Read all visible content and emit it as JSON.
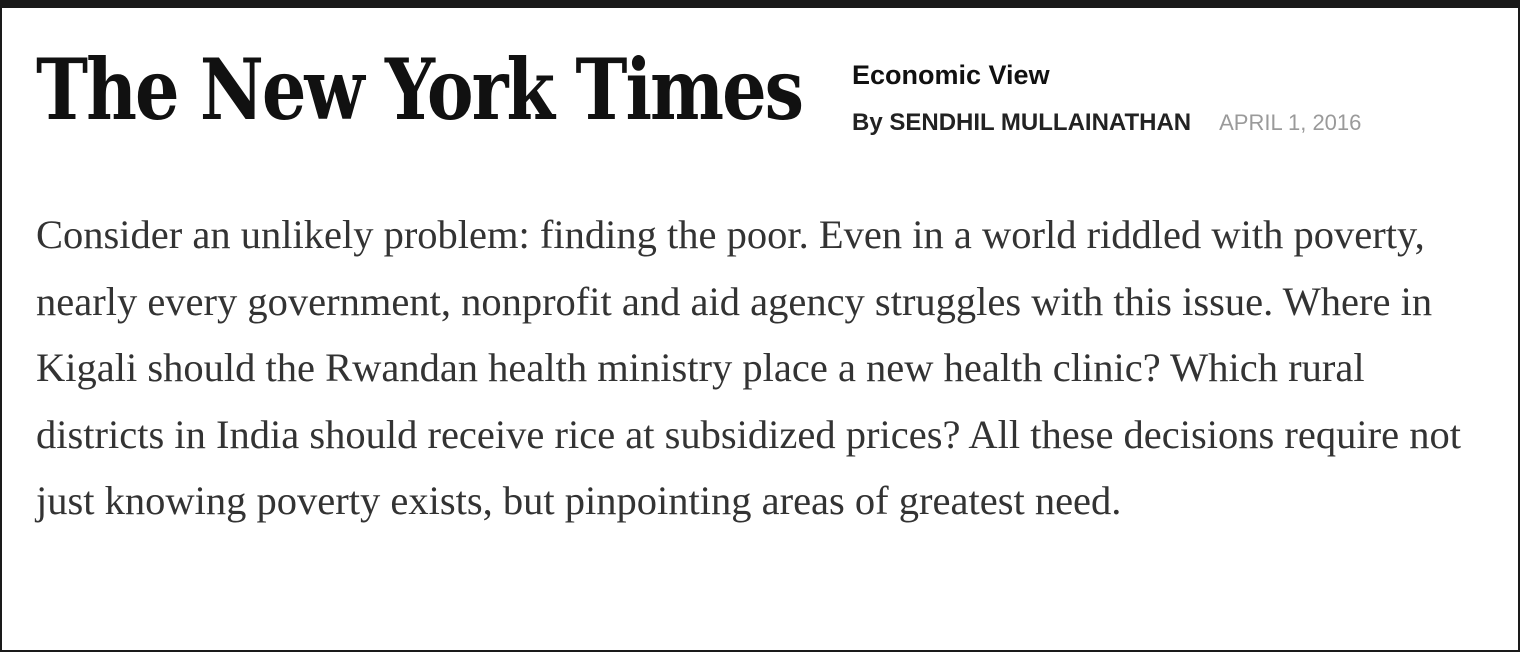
{
  "masthead": {
    "logo_text": "The New York Times"
  },
  "header": {
    "section": "Economic View",
    "byline": "By SENDHIL MULLAINATHAN",
    "date": "APRIL 1, 2016"
  },
  "article": {
    "paragraph": "Consider an unlikely problem: finding the poor. Even in a world riddled with poverty, nearly every government, nonprofit and aid agency struggles with this issue. Where in Kigali should the Rwandan health ministry place a new health clinic? Which rural districts in India should receive rice at subsidized prices? All these decisions require not just knowing poverty exists, but pinpointing areas of greatest need."
  }
}
